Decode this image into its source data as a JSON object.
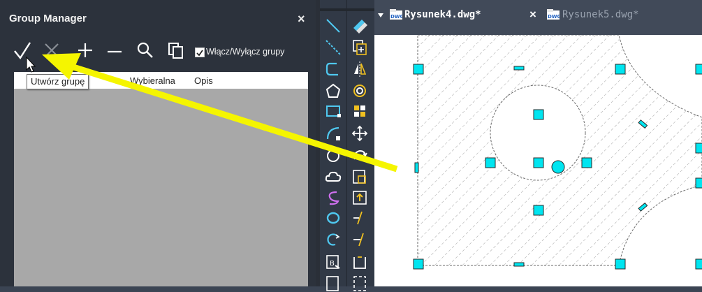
{
  "group_manager": {
    "title": "Group Manager",
    "close": "×",
    "toggle_label": "Włącz/Wyłącz grupy",
    "columns": [
      "Wybieralna",
      "Opis"
    ],
    "tooltip": "Utwórz grupę",
    "toolbar_icons": [
      "checkmark-icon",
      "x-icon",
      "plus-icon",
      "minus-icon",
      "search-icon",
      "copy-icon"
    ]
  },
  "tabs": [
    {
      "label": "Rysunek4.dwg*",
      "active": true,
      "close": "×"
    },
    {
      "label": "Rysunek5.dwg*",
      "active": false
    }
  ],
  "colors": {
    "panel_bg": "#2c323c",
    "list_bg": "#a8a8a8",
    "canvas_bg": "#ffffff",
    "grip_fill": "#00e5f0",
    "arrow": "#f5f500",
    "tool_accent": "#4fc8f0"
  },
  "tools": {
    "left": [
      "line-icon",
      "construction-line-icon",
      "polyline-icon",
      "polygon-icon",
      "rectangle-icon",
      "arc-icon",
      "circle-icon",
      "cloud-icon",
      "spline-icon",
      "ellipse-icon",
      "ellipse-arc-icon",
      "insert-block-icon",
      "make-block-icon"
    ],
    "right": [
      "erase-icon",
      "copy-object-icon",
      "mirror-icon",
      "offset-icon",
      "array-icon",
      "move-icon",
      "rotate-icon",
      "scale-icon",
      "stretch-icon",
      "trim-icon",
      "extend-icon",
      "break-icon",
      "join-icon"
    ]
  }
}
